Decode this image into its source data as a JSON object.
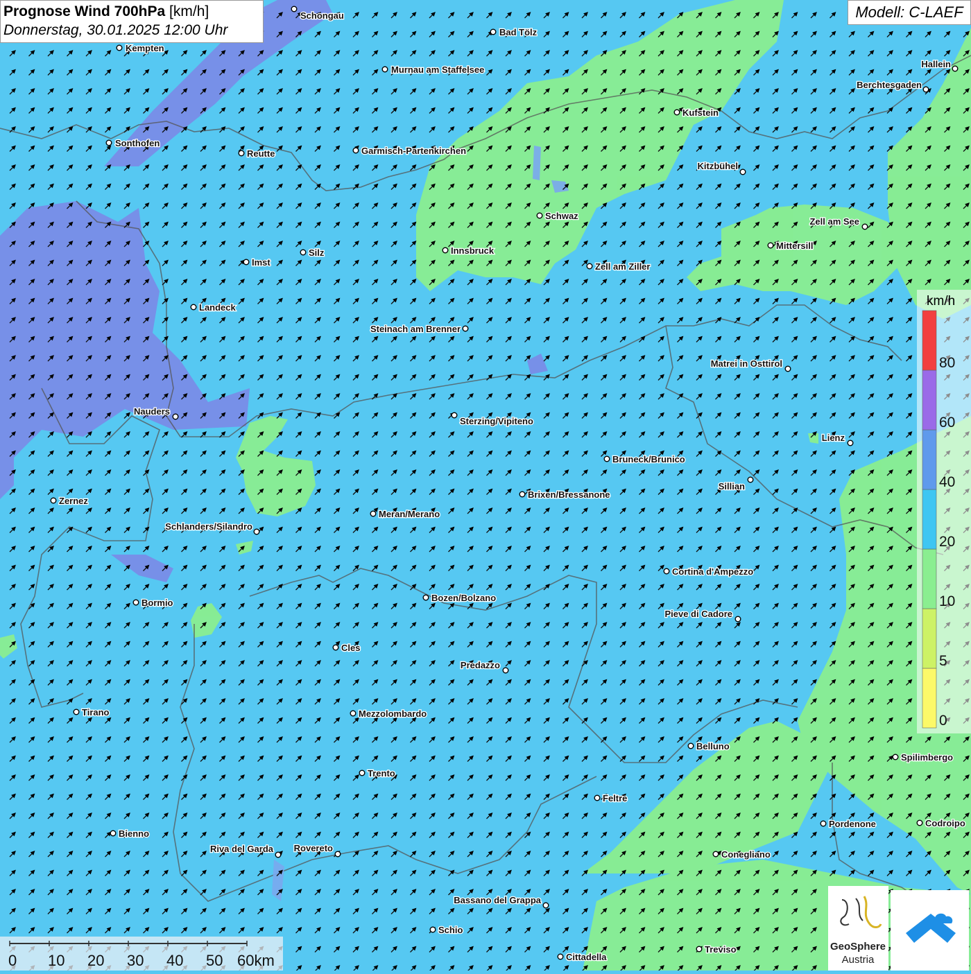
{
  "header": {
    "title": "Prognose Wind 700hPa",
    "unit": "[km/h]",
    "datetime": "Donnerstag, 30.01.2025 12:00 Uhr",
    "model": "Modell: C-LAEF"
  },
  "legend": {
    "unit": "km/h",
    "tick_labels": [
      "0",
      "5",
      "10",
      "20",
      "40",
      "60",
      "80"
    ],
    "bins": [
      {
        "from": 0,
        "to": 5,
        "color": "#fcf968"
      },
      {
        "from": 5,
        "to": 10,
        "color": "#cdf265"
      },
      {
        "from": 10,
        "to": 20,
        "color": "#8aee90"
      },
      {
        "from": 20,
        "to": 40,
        "color": "#3ec6f2"
      },
      {
        "from": 40,
        "to": 60,
        "color": "#5f9aec"
      },
      {
        "from": 60,
        "to": 80,
        "color": "#9a6ae8"
      },
      {
        "from": 80,
        "to": 100,
        "color": "#f23f3f"
      }
    ]
  },
  "scale_bar": {
    "labels": [
      "0",
      "10",
      "20",
      "30",
      "40",
      "50",
      "60km"
    ]
  },
  "logos": {
    "geosphere_line1": "GeoSphere",
    "geosphere_line2": "Austria"
  },
  "wind": {
    "direction": "south-west (arrows point north-east)"
  },
  "places": [
    {
      "name": "Schongau"
    },
    {
      "name": "Bad Tölz"
    },
    {
      "name": "Kempten"
    },
    {
      "name": "Murnau am Staffelsee"
    },
    {
      "name": "Hallein"
    },
    {
      "name": "Berchtesgaden"
    },
    {
      "name": "Kufstein"
    },
    {
      "name": "Sonthofen"
    },
    {
      "name": "Reutte"
    },
    {
      "name": "Garmisch-Partenkirchen"
    },
    {
      "name": "Kitzbühel"
    },
    {
      "name": "Schwaz"
    },
    {
      "name": "Zell am See"
    },
    {
      "name": "Innsbruck"
    },
    {
      "name": "Mittersill"
    },
    {
      "name": "Silz"
    },
    {
      "name": "Imst"
    },
    {
      "name": "Zell am Ziller"
    },
    {
      "name": "Landeck"
    },
    {
      "name": "Steinach am Brenner"
    },
    {
      "name": "Matrei in Osttirol"
    },
    {
      "name": "Nauders"
    },
    {
      "name": "Sterzing/Vipiteno"
    },
    {
      "name": "Lienz"
    },
    {
      "name": "Bruneck/Brunico"
    },
    {
      "name": "Sillian"
    },
    {
      "name": "Brixen/Bressanone"
    },
    {
      "name": "Zernez"
    },
    {
      "name": "Meran/Merano"
    },
    {
      "name": "Schlanders/Silandro"
    },
    {
      "name": "Cortina d'Ampezzo"
    },
    {
      "name": "Bozen/Bolzano"
    },
    {
      "name": "Bormio"
    },
    {
      "name": "Pieve di Cadore"
    },
    {
      "name": "Cles"
    },
    {
      "name": "Predazzo"
    },
    {
      "name": "Tirano"
    },
    {
      "name": "Mezzolombardo"
    },
    {
      "name": "Belluno"
    },
    {
      "name": "Spilimbergo"
    },
    {
      "name": "Trento"
    },
    {
      "name": "Feltre"
    },
    {
      "name": "Pordenone"
    },
    {
      "name": "Codroipo"
    },
    {
      "name": "Bienno"
    },
    {
      "name": "Riva del Garda"
    },
    {
      "name": "Rovereto"
    },
    {
      "name": "Conegliano"
    },
    {
      "name": "Bassano del Grappa"
    },
    {
      "name": "Schio"
    },
    {
      "name": "Treviso"
    },
    {
      "name": "Cittadella"
    }
  ]
}
